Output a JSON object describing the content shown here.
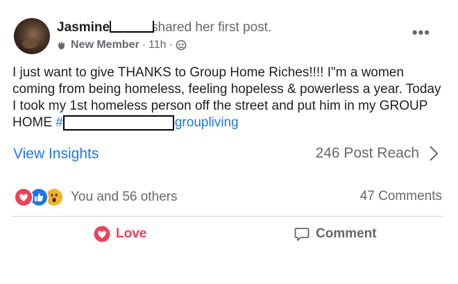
{
  "post": {
    "author": "Jasmine",
    "action": "shared her first post.",
    "badge": "New Member",
    "time": "11h",
    "separator": "·",
    "more_label": "•••",
    "body_text": "I just want to give THANKS to Group Home Riches!!!! I\"m a women coming from being homeless, feeling hopeless & powerless a year. Today I took my 1st homeless person off the street and put him in my GROUP HOME ",
    "hashtag_prefix": "#",
    "hashtag_suffix": "groupliving"
  },
  "insights": {
    "label": "View Insights",
    "reach": "246 Post Reach"
  },
  "stats": {
    "reactions_text": "You and 56 others",
    "comments": "47 Comments"
  },
  "actions": {
    "love": "Love",
    "comment": "Comment"
  },
  "colors": {
    "accent": "#1877f2",
    "love": "#f33e58",
    "muted": "#65676b"
  }
}
